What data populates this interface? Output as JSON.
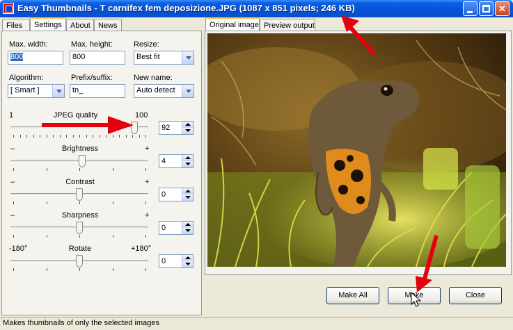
{
  "window": {
    "title": "Easy Thumbnails - T carnifex fem deposizione.JPG  (1087 x 851 pixels;  246 KB)",
    "colors": {
      "titlebar": "#0553d6",
      "close": "#c9431f",
      "annotation": "#e5000d"
    }
  },
  "left_tabs": [
    {
      "label": "Files"
    },
    {
      "label": "Settings",
      "active": true
    },
    {
      "label": "About"
    },
    {
      "label": "News"
    }
  ],
  "right_tabs": [
    {
      "label": "Original image",
      "active": true
    },
    {
      "label": "Preview output"
    }
  ],
  "settings": {
    "max_width": {
      "label": "Max. width:",
      "value": "800"
    },
    "max_height": {
      "label": "Max. height:",
      "value": "800"
    },
    "resize": {
      "label": "Resize:",
      "value": "Best fit"
    },
    "algorithm": {
      "label": "Algorithm:",
      "value": "[ Smart ]"
    },
    "prefix": {
      "label": "Prefix/suffix:",
      "value": "tn_"
    },
    "new_name": {
      "label": "New name:",
      "value": "Auto detect"
    }
  },
  "sliders": {
    "jpeg": {
      "label": "JPEG quality",
      "min_label": "1",
      "max_label": "100",
      "value": "92",
      "level": 0.92
    },
    "brightness": {
      "label": "Brightness",
      "min_label": "–",
      "max_label": "+",
      "value": "4",
      "level": 0.52
    },
    "contrast": {
      "label": "Contrast",
      "min_label": "–",
      "max_label": "+",
      "value": "0",
      "level": 0.5
    },
    "sharpness": {
      "label": "Sharpness",
      "min_label": "–",
      "max_label": "+",
      "value": "0",
      "level": 0.5
    },
    "rotate": {
      "label": "Rotate",
      "min_label": "-180°",
      "max_label": "+180°",
      "value": "0",
      "level": 0.5
    }
  },
  "buttons": {
    "make_all": "Make All",
    "make": "Make",
    "close": "Close"
  },
  "status": "Makes thumbnails of only the selected images"
}
